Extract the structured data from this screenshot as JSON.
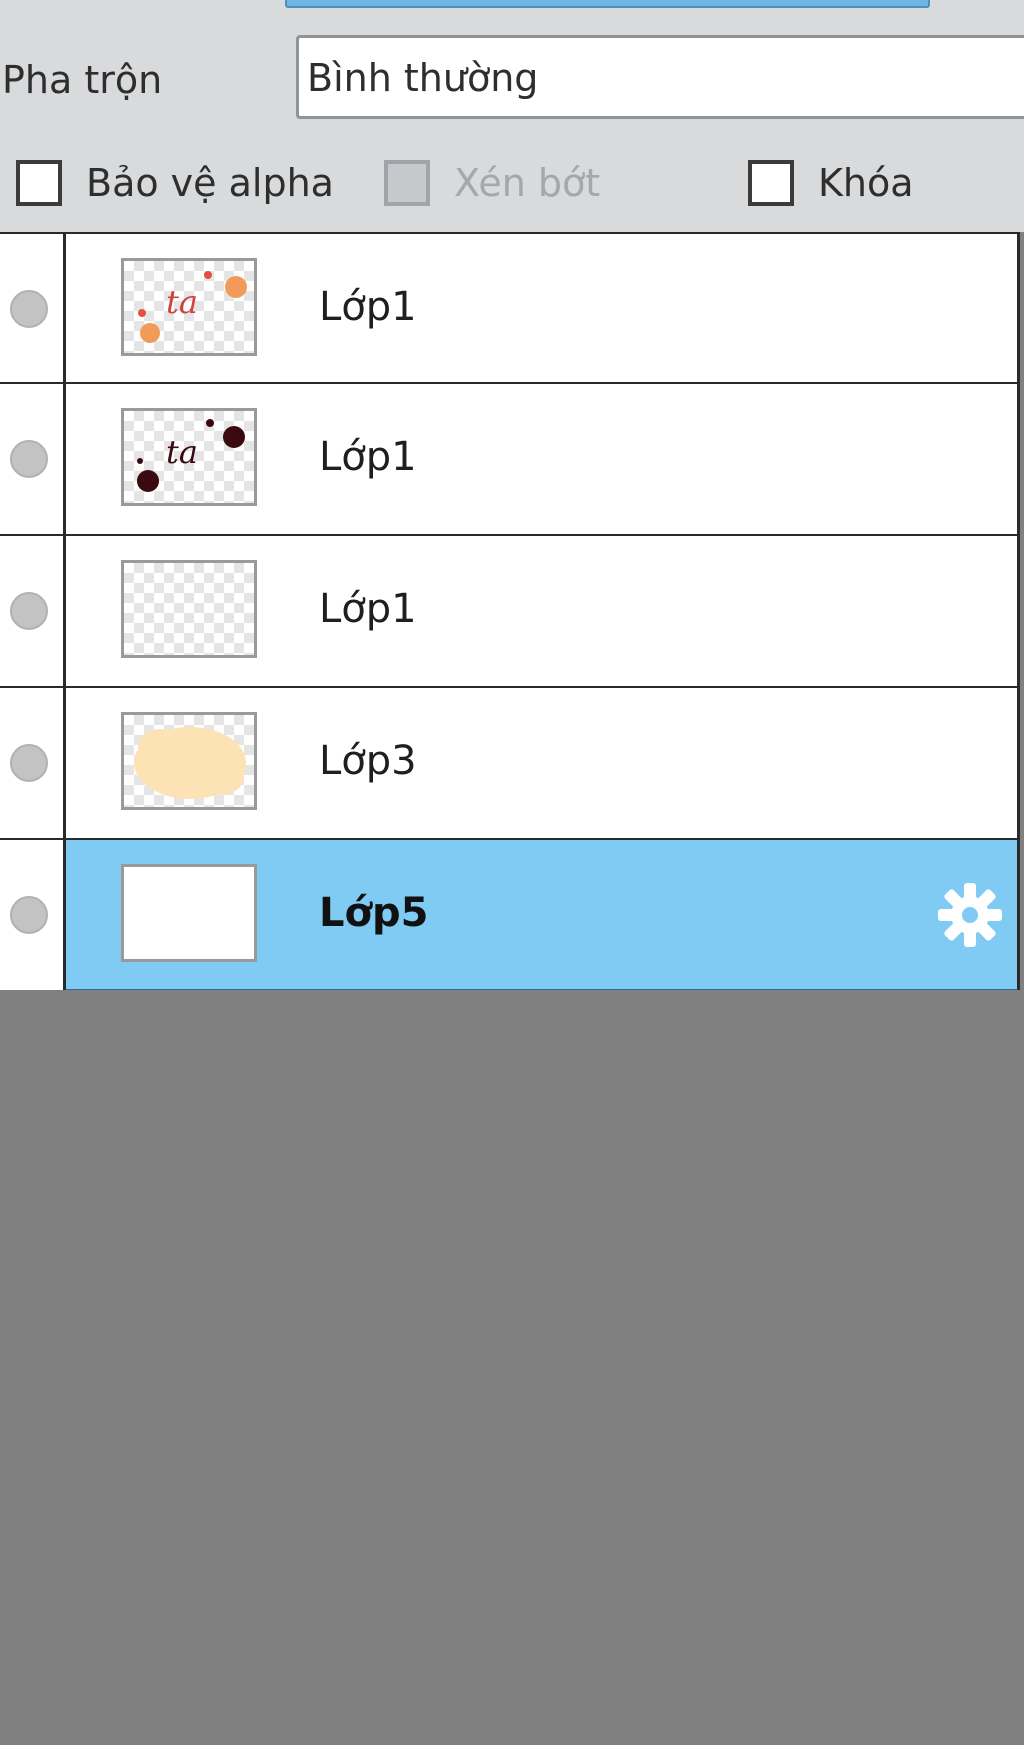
{
  "blend": {
    "label": "Pha trộn",
    "value": "Bình thường"
  },
  "options": {
    "alpha_protect": "Bảo vệ alpha",
    "clip": "Xén bớt",
    "lock": "Khóa"
  },
  "layers": [
    {
      "name": "Lớp1",
      "thumb": "orange-splash-art-icon",
      "selected": false
    },
    {
      "name": "Lớp1",
      "thumb": "dark-splash-art-icon",
      "selected": false
    },
    {
      "name": "Lớp1",
      "thumb": "empty-transparent-icon",
      "selected": false
    },
    {
      "name": "Lớp3",
      "thumb": "peach-blob-icon",
      "selected": false
    },
    {
      "name": "Lớp5",
      "thumb": "white-fill-icon",
      "selected": true
    }
  ],
  "colors": {
    "selected_row": "#7fcbf3",
    "panel_bg": "#d8dadc",
    "empty_bg": "#808080"
  }
}
